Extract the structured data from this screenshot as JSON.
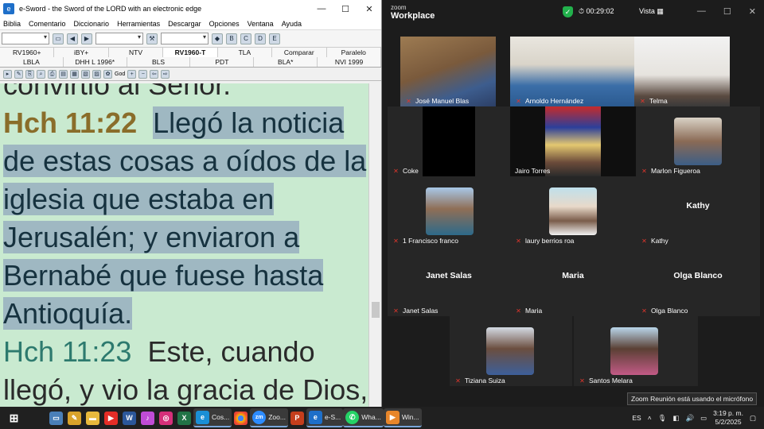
{
  "esword": {
    "title": "e-Sword - the Sword of the LORD with an electronic edge",
    "menu": [
      "Biblia",
      "Comentario",
      "Diccionario",
      "Herramientas",
      "Descargar",
      "Opciones",
      "Ventana",
      "Ayuda"
    ],
    "tabs_row1": [
      "RV1960+",
      "iBY+",
      "NTV",
      "RV1960-T",
      "TLA",
      "Comparar",
      "Paralelo"
    ],
    "tabs_row2": [
      "LBLA",
      "DHH L 1996*",
      "BLS",
      "PDT",
      "BLA*",
      "NVI 1999"
    ],
    "active_tab": "RV1960-T",
    "toolbar_god_label": "God",
    "reader": {
      "top_fragment": "convirtió al Señor.",
      "verse1_ref": "Hch 11:22",
      "verse1_text": "Llegó la noticia de estas cosas a oídos de la iglesia que estaba en Jerusalén; y enviaron a Bernabé que fuese hasta Antioquía.",
      "verse2_ref": "Hch 11:23",
      "verse2_text": "Este, cuando llegó, y vio la gracia de Dios,"
    }
  },
  "zoom": {
    "logo_small": "zoom",
    "logo_big": "Workplace",
    "timer": "00:29:02",
    "view_label": "Vista",
    "participants": [
      {
        "name": "José Manuel Blas",
        "muted": true
      },
      {
        "name": "Arnoldo Hernández",
        "muted": true
      },
      {
        "name": "Telma",
        "muted": true
      },
      {
        "name": "Coke",
        "muted": true
      },
      {
        "name": "Jairo Torres",
        "muted": false
      },
      {
        "name": "Marlon Figueroa",
        "muted": true
      },
      {
        "name": "1 Francisco franco",
        "muted": true
      },
      {
        "name": "laury berrios roa",
        "muted": true
      },
      {
        "name": "Kathy",
        "muted": true,
        "center_label": "Kathy"
      },
      {
        "name": "Janet Salas",
        "muted": true,
        "center_label": "Janet Salas"
      },
      {
        "name": "Maria",
        "muted": true,
        "center_label": "Maria"
      },
      {
        "name": "Olga Blanco",
        "muted": true,
        "center_label": "Olga Blanco"
      },
      {
        "name": "Tiziana Suiza",
        "muted": true
      },
      {
        "name": "Santos Melara",
        "muted": true
      }
    ],
    "mic_notice": "Zoom Reunión está usando el micrófono"
  },
  "taskbar": {
    "apps": [
      {
        "label": "",
        "icon": "windows-start"
      },
      {
        "label": "",
        "icon": "computer"
      },
      {
        "label": "",
        "icon": "paint"
      },
      {
        "label": "",
        "icon": "folder"
      },
      {
        "label": "",
        "icon": "youtube"
      },
      {
        "label": "",
        "icon": "word"
      },
      {
        "label": "",
        "icon": "itunes"
      },
      {
        "label": "",
        "icon": "instagram"
      },
      {
        "label": "",
        "icon": "excel"
      },
      {
        "label": "Cos...",
        "icon": "edge"
      },
      {
        "label": "",
        "icon": "chrome"
      },
      {
        "label": "Zoo...",
        "icon": "zoom"
      },
      {
        "label": "",
        "icon": "powerpoint"
      },
      {
        "label": "e-S...",
        "icon": "esword"
      },
      {
        "label": "Wha...",
        "icon": "whatsapp"
      },
      {
        "label": "Win...",
        "icon": "media-player"
      }
    ],
    "lang": "ES",
    "time": "3:19 p. m.",
    "date": "5/2/2025"
  },
  "colors": {
    "reader_bg": "#c9ead0",
    "highlight": "#9fb8c2",
    "ref1": "#8a6d2a",
    "ref2": "#2d7a6e",
    "zoom_bg": "#1c1c1c",
    "speaker_outline": "#23d65a"
  }
}
